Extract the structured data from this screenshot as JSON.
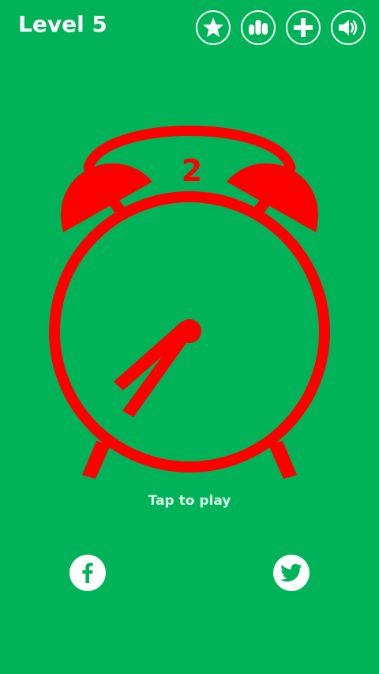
{
  "header": {
    "level_label": "Level 5"
  },
  "toolbar": {
    "icons": [
      "star-icon",
      "leaderboard-icon",
      "plus-icon",
      "sound-icon"
    ]
  },
  "clock": {
    "countdown": "2",
    "color": "#ff0000"
  },
  "prompt": {
    "tap_label": "Tap to play"
  },
  "social": {
    "icons": [
      "facebook-icon",
      "twitter-icon"
    ]
  },
  "colors": {
    "background": "#00b359",
    "accent": "#ff0000",
    "foreground": "#ffffff"
  }
}
